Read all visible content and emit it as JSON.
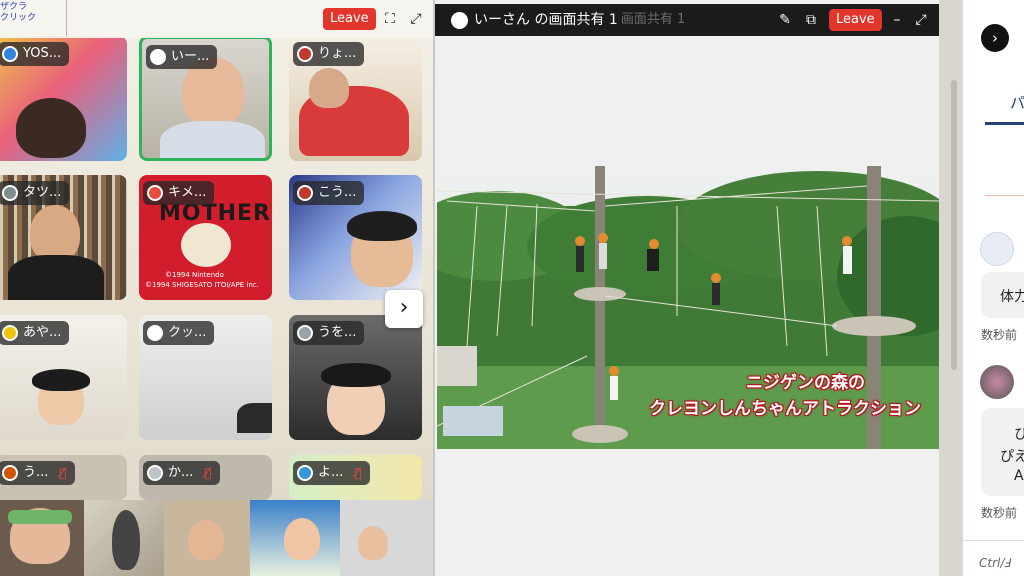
{
  "left_window": {
    "corner_text": [
      "ザクラ",
      "クリック"
    ],
    "leave_label": "Leave",
    "tiles": [
      {
        "name": "YOS...",
        "avatar_color": "#2e86de",
        "muted": false
      },
      {
        "name": "いー...",
        "avatar_color": "#ffffff",
        "muted": false,
        "active": true
      },
      {
        "name": "りょ...",
        "avatar_color": "#c0392b",
        "muted": false
      },
      {
        "name": "タツ...",
        "avatar_color": "#7f8c8d",
        "muted": false
      },
      {
        "name": "キメ...",
        "avatar_color": "#e74c3c",
        "muted": false
      },
      {
        "name": "こう...",
        "avatar_color": "#c0392b",
        "muted": false
      },
      {
        "name": "あや...",
        "avatar_color": "#f1c40f",
        "muted": false
      },
      {
        "name": "クッ...",
        "avatar_color": "#ffffff",
        "muted": false
      },
      {
        "name": "うを...",
        "avatar_color": "#95a5a6",
        "muted": false
      },
      {
        "name": "う...",
        "avatar_color": "#d35400",
        "muted": true
      },
      {
        "name": "か...",
        "avatar_color": "#bdc3c7",
        "muted": true
      },
      {
        "name": "よ...",
        "avatar_color": "#3498db",
        "muted": true
      }
    ],
    "tile_text": {
      "mother": "MOTHER",
      "nintendo": "©1994 Nintendo",
      "copyright": "©1994 SHIGESATO ITOI/APE inc."
    },
    "next_icon": "chevron-right-icon"
  },
  "share_window": {
    "title": "いーさん の画面共有 1",
    "ghost_title": "画面共有 1",
    "leave_label": "Leave",
    "caption_line1": "ニジゲンの森の",
    "caption_line2": "クレヨンしんちゃんアトラクション"
  },
  "chat_panel": {
    "tab_label": "パ",
    "messages": [
      {
        "text": "体力",
        "timestamp": "数秒前"
      },
      {
        "lines": [
          "ひ",
          "ぴえ",
          "A"
        ],
        "timestamp": "数秒前"
      }
    ],
    "input_hint": "Ctrl/Ⅎ"
  }
}
